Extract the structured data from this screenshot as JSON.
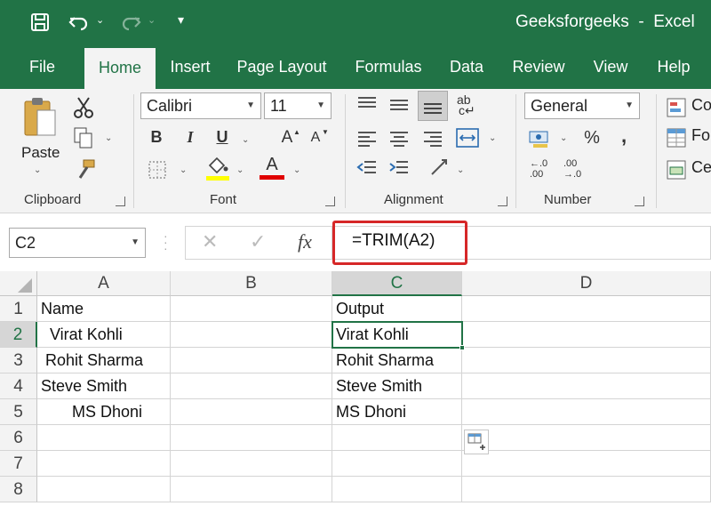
{
  "titlebar": {
    "title": "Geeksforgeeks  -  Excel"
  },
  "tabs": [
    "File",
    "Home",
    "Insert",
    "Page Layout",
    "Formulas",
    "Data",
    "Review",
    "View",
    "Help"
  ],
  "ribbon": {
    "clipboard": {
      "paste_label": "Paste",
      "group_label": "Clipboard"
    },
    "font": {
      "name": "Calibri",
      "size": "11",
      "bold": "B",
      "italic": "I",
      "underline": "U",
      "grow": "A",
      "shrink": "A",
      "font_color": "A",
      "group_label": "Font",
      "highlight_color": "#ffff00",
      "text_color": "#e00000"
    },
    "alignment": {
      "group_label": "Alignment",
      "wrap_glyph": "ab"
    },
    "number": {
      "format": "General",
      "percent": "%",
      "comma": ",",
      "group_label": "Number",
      "inc_decimal_top": "←.0",
      "inc_decimal_bottom": ".00",
      "dec_decimal_top": ".00",
      "dec_decimal_bottom": "→.0"
    },
    "styles": {
      "item1": "Co",
      "item2": "Fo",
      "item3": "Ce"
    }
  },
  "formula_bar": {
    "name_box": "C2",
    "cancel": "✕",
    "enter": "✓",
    "fx": "fx",
    "formula": "=TRIM(A2)",
    "highlight_color": "#d62728"
  },
  "grid": {
    "columns": [
      "A",
      "B",
      "C",
      "D"
    ],
    "rows": [
      "1",
      "2",
      "3",
      "4",
      "5",
      "6",
      "7",
      "8"
    ],
    "col_a": [
      "Name",
      "  Virat Kohli",
      " Rohit Sharma",
      "Steve Smith",
      "       MS Dhoni",
      "",
      "",
      ""
    ],
    "col_c": [
      "Output",
      "Virat Kohli",
      "Rohit Sharma",
      "Steve Smith",
      "MS Dhoni",
      "",
      "",
      ""
    ],
    "selected_cell": "C2"
  },
  "colors": {
    "excel_green": "#217346"
  }
}
